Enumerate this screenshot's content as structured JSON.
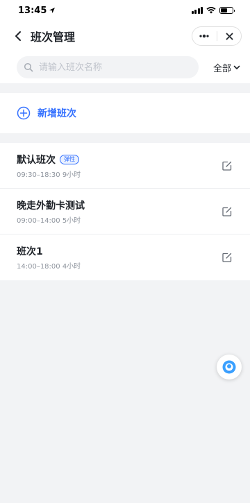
{
  "status_bar": {
    "time": "13:45"
  },
  "header": {
    "title": "班次管理"
  },
  "search": {
    "placeholder": "请输入班次名称",
    "value": ""
  },
  "filter": {
    "label": "全部"
  },
  "add": {
    "label": "新增班次"
  },
  "shifts": [
    {
      "name": "默认班次",
      "badge": "弹性",
      "time": "09:30–18:30 9小时"
    },
    {
      "name": "晚走外勤卡测试",
      "badge": "",
      "time": "09:00–14:00 5小时"
    },
    {
      "name": "班次1",
      "badge": "",
      "time": "14:00–18:00 4小时"
    }
  ],
  "colors": {
    "accent": "#3370ff",
    "background": "#f2f3f5",
    "text": "#1f2329",
    "subtext": "#8f959e"
  },
  "icons": [
    "location-arrow-icon",
    "signal-icon",
    "wifi-icon",
    "battery-icon",
    "back-arrow-icon",
    "more-icon",
    "close-icon",
    "search-icon",
    "chevron-down-icon",
    "add-circle-icon",
    "edit-icon",
    "assistant-icon"
  ]
}
